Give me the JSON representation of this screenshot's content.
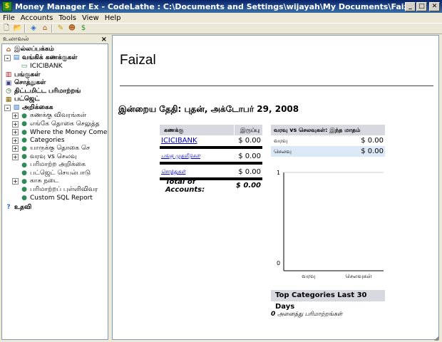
{
  "window": {
    "title": "Money Manager Ex - CodeLathe : C:\\Documents and Settings\\wijayah\\My Documents\\Faizal.mmb",
    "minimize": "_",
    "maximize": "□",
    "close": "✕"
  },
  "menu": [
    "File",
    "Accounts",
    "Tools",
    "View",
    "Help"
  ],
  "toolbar": [
    "new-icon",
    "open-icon",
    "new-account-icon",
    "home-icon",
    "options-icon",
    "users-icon",
    "currency-icon"
  ],
  "navigator": {
    "header": "உலாவல்",
    "close": "×",
    "items": [
      {
        "label": "இல்லப்பக்கம்",
        "bold": true,
        "level": 0,
        "icon": "home-icon"
      },
      {
        "label": "வங்கிக் கணக்குகள்",
        "bold": true,
        "level": 0,
        "icon": "bank-icon",
        "expander": "-"
      },
      {
        "label": "ICICIBANK",
        "bold": false,
        "level": 2,
        "icon": "account-icon"
      },
      {
        "label": "பங்குகள்",
        "bold": true,
        "level": 0,
        "icon": "stocks-icon"
      },
      {
        "label": "சொத்துகள்",
        "bold": true,
        "level": 0,
        "icon": "assets-icon"
      },
      {
        "label": "திட்டமிட்ட பரிமாற்றங்",
        "bold": true,
        "level": 0,
        "icon": "scheduled-icon"
      },
      {
        "label": "பட்ஜெட்",
        "bold": true,
        "level": 0,
        "icon": "budget-icon"
      },
      {
        "label": "அறிக்கைக",
        "bold": true,
        "level": 0,
        "icon": "reports-icon",
        "expander": "-"
      },
      {
        "label": "கணக்கு விவரங்கள்",
        "bold": false,
        "level": 1,
        "icon": "report-globe-icon",
        "expander": "+"
      },
      {
        "label": "எங்கே தொகை செலுத்த",
        "bold": false,
        "level": 1,
        "icon": "report-globe-icon",
        "expander": "+"
      },
      {
        "label": "Where the Money Comes Fr",
        "bold": false,
        "level": 1,
        "icon": "report-globe-icon",
        "expander": "+"
      },
      {
        "label": "Categories",
        "bold": false,
        "level": 1,
        "icon": "report-globe-icon",
        "expander": "+"
      },
      {
        "label": "யாருக்கு தொகை செ",
        "bold": false,
        "level": 1,
        "icon": "report-globe-icon",
        "expander": "+"
      },
      {
        "label": "வரவு vs செலவு",
        "bold": false,
        "level": 1,
        "icon": "report-globe-icon",
        "expander": "+"
      },
      {
        "label": "பரிமாற்ற அறிக்கை",
        "bold": false,
        "level": 1,
        "icon": "report-globe-icon"
      },
      {
        "label": "பட்ஜெட் செயல்பாடு",
        "bold": false,
        "level": 1,
        "icon": "report-globe-icon"
      },
      {
        "label": "காசு நடை",
        "bold": false,
        "level": 1,
        "icon": "report-globe-icon",
        "expander": "+"
      },
      {
        "label": "பரிமாற்றப் புள்ளிவிவர",
        "bold": false,
        "level": 1,
        "icon": "report-globe-icon"
      },
      {
        "label": "Custom SQL Report",
        "bold": false,
        "level": 1,
        "icon": "report-globe-icon"
      },
      {
        "label": "உதவி",
        "bold": true,
        "level": 0,
        "icon": "help-icon"
      }
    ]
  },
  "home": {
    "title": "Faizal",
    "today": "இன்றைய தேதி: புதன், அக்டோபர் 29, 2008",
    "accounts_table": {
      "col_account": "கணக்கு",
      "col_balance": "இருப்பு",
      "rows": [
        {
          "name": "ICICIBANK",
          "balance": "$ 0.00",
          "small": false
        },
        {
          "name": "பங்கு முதலீடுகள்",
          "balance": "$ 0.00",
          "small": true
        },
        {
          "name": "சொத்துகள்",
          "balance": "$ 0.00",
          "small": true
        }
      ],
      "total_label": "Total of Accounts:",
      "total_value": "$ 0.00"
    },
    "income_expense": {
      "header": "வரவு vs செலவுகள்: இந்த மாதம்",
      "income_label": "வரவு",
      "income_value": "$ 0.00",
      "expense_label": "செலவு",
      "expense_value": "$ 0.00"
    },
    "top_categories": "Top Categories Last 30 Days",
    "transactions_count": "0",
    "transactions_label": "அனைத்து பரிமாற்றங்கள்"
  },
  "chart_data": {
    "type": "bar",
    "categories": [
      "வரவு",
      "செலவுகள்"
    ],
    "values": [
      0,
      0
    ],
    "title": "",
    "xlabel": "",
    "ylabel": "",
    "ylim": [
      0,
      1
    ],
    "yticks": [
      "0",
      "1"
    ],
    "grid": false
  }
}
